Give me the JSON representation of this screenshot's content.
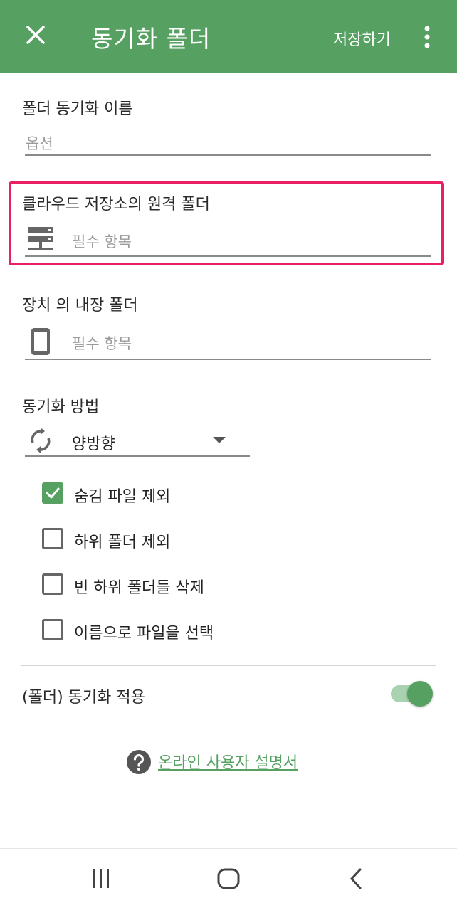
{
  "appbar": {
    "title": "동기화 폴더",
    "save_label": "저장하기",
    "close_icon": "close-icon",
    "more_icon": "more-vert-icon",
    "bg_color": "#56a062"
  },
  "form": {
    "name_field": {
      "label": "폴더 동기화 이름",
      "placeholder": "옵션"
    },
    "remote_folder": {
      "label": "클라우드 저장소의 원격 폴더",
      "placeholder": "필수 항목",
      "icon": "server-icon"
    },
    "local_folder": {
      "label": "장치 의 내장 폴더",
      "placeholder": "필수 항목",
      "icon": "phone-icon"
    },
    "sync_method": {
      "label": "동기화 방법",
      "value": "양방향",
      "icon": "sync-icon"
    },
    "options": [
      {
        "label": "숨김 파일 제외",
        "checked": true
      },
      {
        "label": "하위 폴더 제외",
        "checked": false
      },
      {
        "label": "빈 하위 폴더들 삭제",
        "checked": false
      },
      {
        "label": "이름으로 파일을 선택",
        "checked": false
      }
    ],
    "apply_toggle": {
      "label": "(폴더) 동기화 적용",
      "on": true
    }
  },
  "help": {
    "link_text": "온라인 사용자 설명서",
    "icon": "help-icon"
  },
  "navbar": {
    "recent_icon": "recent-apps-icon",
    "home_icon": "home-icon",
    "back_icon": "back-icon"
  },
  "colors": {
    "accent": "#56a062",
    "highlight": "#ea1e63"
  }
}
